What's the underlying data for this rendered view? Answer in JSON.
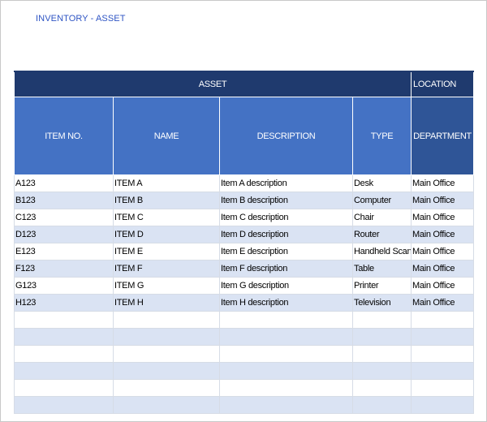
{
  "title": "INVENTORY - ASSET",
  "group_headers": {
    "asset": "ASSET",
    "location": "LOCATION"
  },
  "columns": [
    "ITEM NO.",
    "NAME",
    "DESCRIPTION",
    "TYPE",
    "DEPARTMENT"
  ],
  "rows": [
    [
      "A123",
      "ITEM A",
      "Item A description",
      "Desk",
      "Main Office"
    ],
    [
      "B123",
      "ITEM B",
      "Item B description",
      "Computer",
      "Main Office"
    ],
    [
      "C123",
      "ITEM C",
      "Item C description",
      "Chair",
      "Main Office"
    ],
    [
      "D123",
      "ITEM D",
      "Item D description",
      "Router",
      "Main Office"
    ],
    [
      "E123",
      "ITEM E",
      "Item E description",
      "Handheld Scan",
      "Main Office"
    ],
    [
      "F123",
      "ITEM F",
      "Item F description",
      "Table",
      "Main Office"
    ],
    [
      "G123",
      "ITEM G",
      "Item G description",
      "Printer",
      "Main Office"
    ],
    [
      "H123",
      "ITEM H",
      "Item H description",
      "Television",
      "Main Office"
    ],
    [
      "",
      "",
      "",
      "",
      ""
    ],
    [
      "",
      "",
      "",
      "",
      ""
    ],
    [
      "",
      "",
      "",
      "",
      ""
    ],
    [
      "",
      "",
      "",
      "",
      ""
    ],
    [
      "",
      "",
      "",
      "",
      ""
    ],
    [
      "",
      "",
      "",
      "",
      ""
    ]
  ],
  "colors": {
    "title": "#2f55c4",
    "group_header": "#1f3a6e",
    "column_header": "#4472c4",
    "department_header": "#2f5597",
    "band": "#dae3f3"
  }
}
